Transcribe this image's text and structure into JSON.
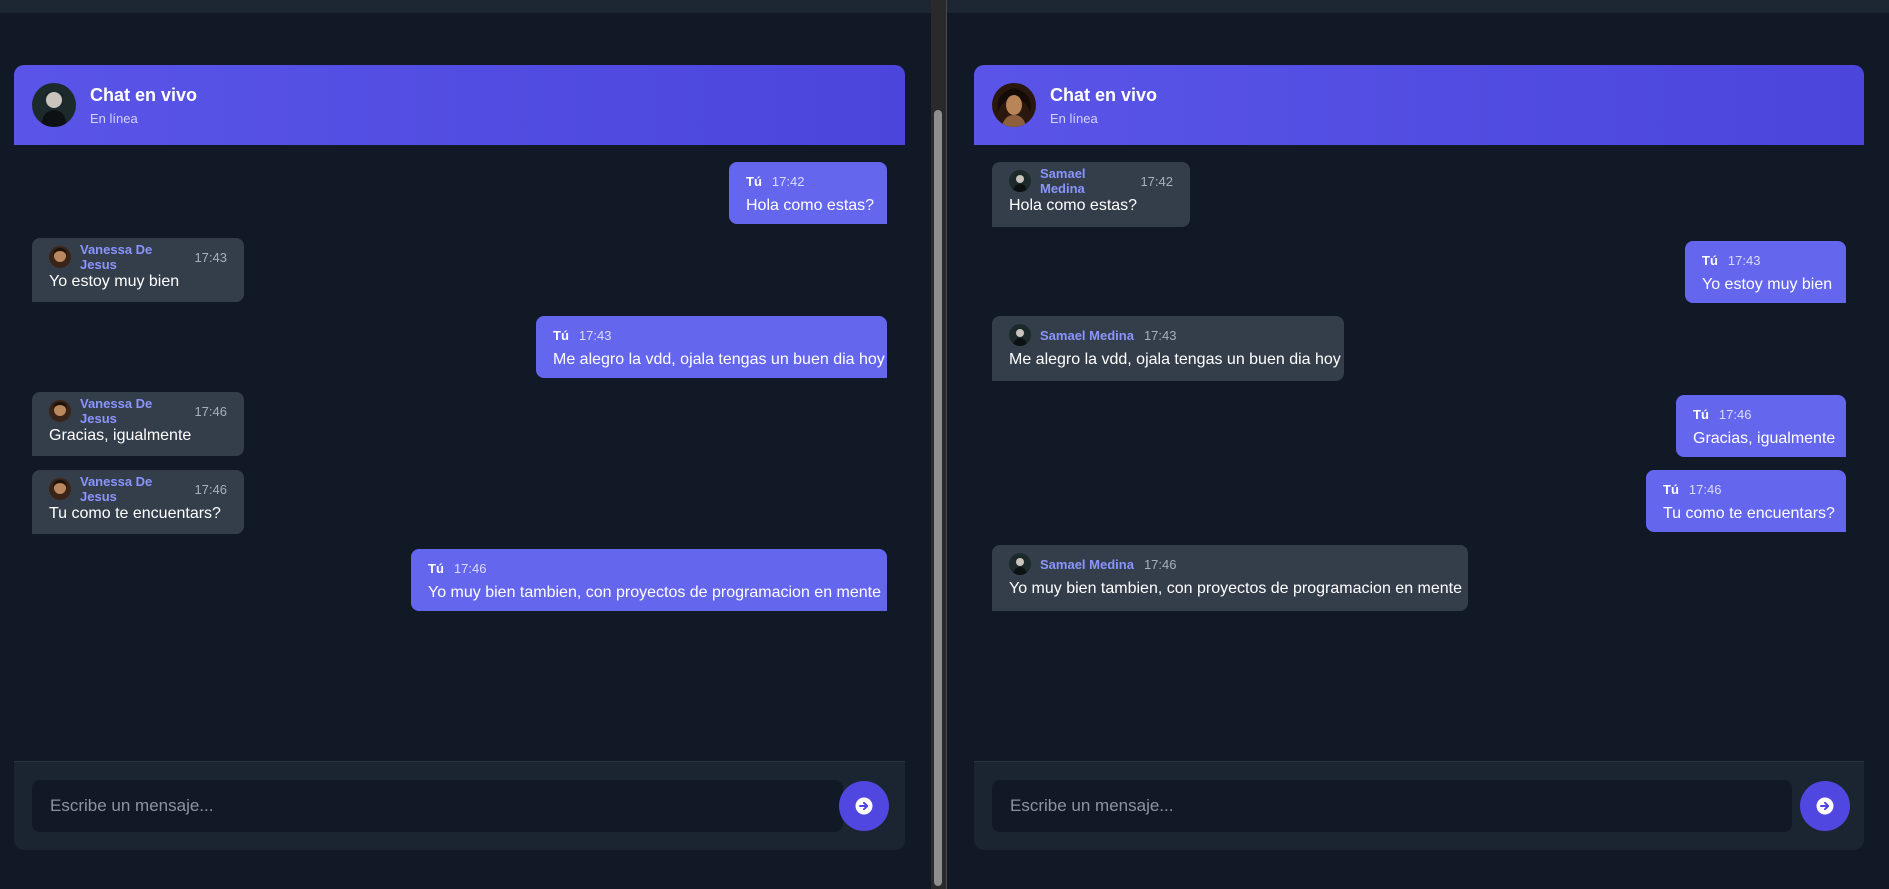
{
  "left": {
    "header": {
      "title": "Chat en vivo",
      "status": "En línea",
      "avatar": "dark-haired-man-avatar"
    },
    "input": {
      "placeholder": "Escribe un mensaje..."
    },
    "send_icon": "arrow-right-circle-icon",
    "messages": [
      {
        "own": true,
        "sender": "Tú",
        "time": "17:42",
        "text": "Hola como estas?"
      },
      {
        "own": false,
        "sender": "Vanessa De Jesus",
        "time": "17:43",
        "text": "Yo estoy muy bien"
      },
      {
        "own": true,
        "sender": "Tú",
        "time": "17:43",
        "text": "Me alegro la vdd, ojala tengas un buen dia hoy"
      },
      {
        "own": false,
        "sender": "Vanessa De Jesus",
        "time": "17:46",
        "text": "Gracias, igualmente"
      },
      {
        "own": false,
        "sender": "Vanessa De Jesus",
        "time": "17:46",
        "text": "Tu como te encuentars?"
      },
      {
        "own": true,
        "sender": "Tú",
        "time": "17:46",
        "text": "Yo muy bien tambien, con proyectos de programacion en mente"
      }
    ]
  },
  "right": {
    "header": {
      "title": "Chat en vivo",
      "status": "En línea",
      "avatar": "curly-haired-woman-avatar"
    },
    "input": {
      "placeholder": "Escribe un mensaje..."
    },
    "send_icon": "arrow-right-circle-icon",
    "messages": [
      {
        "own": false,
        "sender": "Samael Medina",
        "time": "17:42",
        "text": "Hola como estas?"
      },
      {
        "own": true,
        "sender": "Tú",
        "time": "17:43",
        "text": "Yo estoy muy bien"
      },
      {
        "own": false,
        "sender": "Samael Medina",
        "time": "17:43",
        "text": "Me alegro la vdd, ojala tengas un buen dia hoy"
      },
      {
        "own": true,
        "sender": "Tú",
        "time": "17:46",
        "text": "Gracias, igualmente"
      },
      {
        "own": true,
        "sender": "Tú",
        "time": "17:46",
        "text": "Tu como te encuentars?"
      },
      {
        "own": false,
        "sender": "Samael Medina",
        "time": "17:46",
        "text": "Yo muy bien tambien, con proyectos de programacion en mente"
      }
    ]
  },
  "colors": {
    "own_bubble": "#6466ee",
    "other_bubble": "#343e4b",
    "header": "#5047e0",
    "background": "#111926"
  }
}
